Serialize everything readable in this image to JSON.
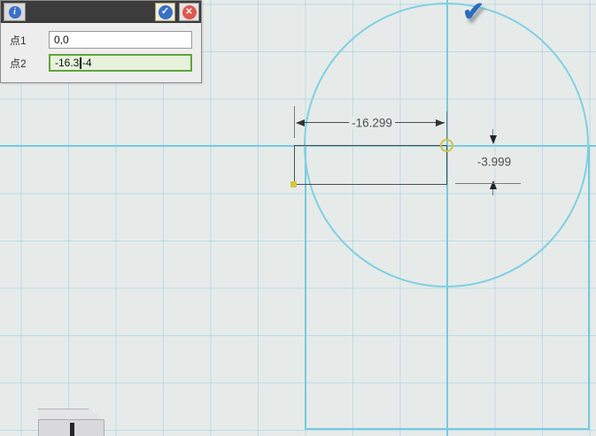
{
  "dialog": {
    "titlebar": {
      "info_glyph": "i",
      "confirm_glyph": "✓",
      "close_glyph": "✕"
    },
    "fields": [
      {
        "label": "点1",
        "value": "0,0"
      },
      {
        "label": "点2",
        "value_before_cursor": "-16.3",
        "value_after_cursor": "-4"
      }
    ]
  },
  "scene": {
    "dimensions": {
      "horizontal": {
        "label": "-16.299"
      },
      "vertical": {
        "label": "-3.999"
      }
    },
    "cursor_check_glyph": "✔",
    "icons": {
      "origin_marker": "highlighted-origin-ring",
      "corner_marker": "corner-point-dot",
      "view_cube": "navigation-cube"
    },
    "colors": {
      "axis_cyan": "#74cbdf",
      "circle_cyan": "#7fd0e2",
      "sketch_gray": "#4e4e4e",
      "highlight_yellow": "#d2c23c",
      "confirm_blue": "#3a6fc6",
      "close_red": "#dd584f",
      "active_field_green": "#61a33b",
      "background": "#e6ebea"
    }
  }
}
